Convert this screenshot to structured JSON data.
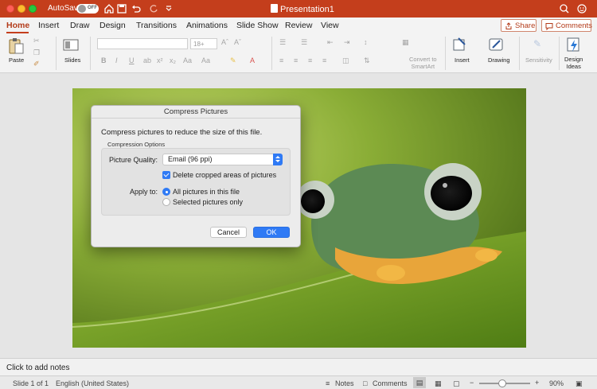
{
  "titlebar": {
    "autosave_label": "AutoSave",
    "autosave_state": "OFF",
    "document_title": "Presentation1"
  },
  "ribbon": {
    "tabs": [
      "Home",
      "Insert",
      "Draw",
      "Design",
      "Transitions",
      "Animations",
      "Slide Show",
      "Review",
      "View"
    ],
    "active_tab": "Home",
    "share_label": "Share",
    "comments_label": "Comments",
    "font_size": "18+",
    "groups": {
      "paste": "Paste",
      "slides": "Slides",
      "convert": "Convert to\nSmartArt",
      "insert": "Insert",
      "drawing": "Drawing",
      "sensitivity": "Sensitivity",
      "design_ideas": "Design\nIdeas"
    }
  },
  "dialog": {
    "title": "Compress Pictures",
    "description": "Compress pictures to reduce the size of this file.",
    "group_title": "Compression Options",
    "quality_label": "Picture Quality:",
    "quality_value": "Email (96 ppi)",
    "delete_cropped_label": "Delete cropped areas of pictures",
    "delete_cropped_checked": true,
    "apply_to_label": "Apply to:",
    "apply_options": [
      "All pictures in this file",
      "Selected pictures only"
    ],
    "apply_selected": "All pictures in this file",
    "cancel_label": "Cancel",
    "ok_label": "OK"
  },
  "notes": {
    "placeholder": "Click to add notes"
  },
  "status": {
    "slide": "Slide 1 of 1",
    "language": "English (United States)",
    "notes_label": "Notes",
    "comments_label": "Comments",
    "zoom_minus": "−",
    "zoom_plus": "+",
    "zoom": "90%",
    "zoom_fraction": 0.5
  },
  "colors": {
    "accent": "#c43e1c",
    "button_blue": "#2f7af5"
  },
  "icons": [
    "home-icon",
    "save-icon",
    "undo-icon",
    "redo-icon",
    "search-icon",
    "smiley-icon",
    "share-icon",
    "comment-icon"
  ]
}
